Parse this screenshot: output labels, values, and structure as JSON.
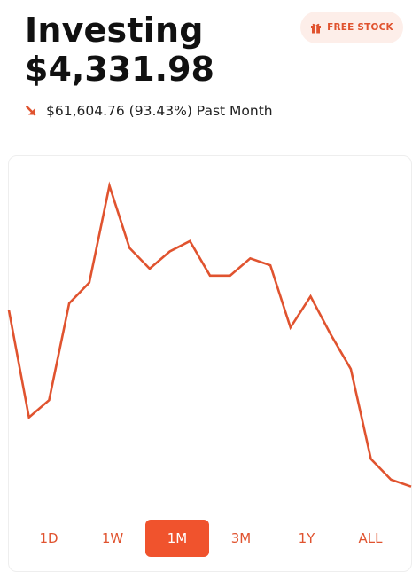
{
  "header": {
    "title": "Investing",
    "balance": "$4,331.98"
  },
  "promo": {
    "label": "FREE STOCK",
    "icon": "gift-icon"
  },
  "change": {
    "icon": "arrow-down-right-icon",
    "text": "$61,604.76 (93.43%) Past Month"
  },
  "colors": {
    "accent": "#f0532d",
    "accent_text": "#e0532f",
    "promo_bg": "#fdeee9",
    "line": "#e0532f"
  },
  "chart_data": {
    "type": "line",
    "x_count": 21,
    "values": [
      58,
      27,
      32,
      60,
      66,
      94,
      76,
      70,
      75,
      78,
      68,
      68,
      73,
      71,
      53,
      62,
      51,
      41,
      15,
      9,
      7
    ],
    "ylim": [
      0,
      100
    ],
    "grid": false,
    "legend": "none"
  },
  "range_selector": {
    "options": [
      "1D",
      "1W",
      "1M",
      "3M",
      "1Y",
      "ALL"
    ],
    "selected_index": 2
  }
}
